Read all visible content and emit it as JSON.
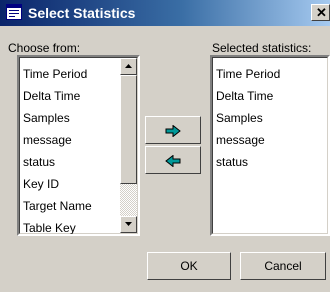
{
  "window": {
    "title": "Select Statistics",
    "close_label": "✕"
  },
  "left_panel": {
    "label": "Choose from:",
    "items": [
      "Time Period",
      "Delta Time",
      "Samples",
      "message",
      "status",
      "Key ID",
      "Target Name",
      "Table Key"
    ]
  },
  "right_panel": {
    "label": "Selected statistics:",
    "items": [
      "Time Period",
      "Delta Time",
      "Samples",
      "message",
      "status"
    ]
  },
  "transfer": {
    "add_icon": "arrow-right-icon",
    "remove_icon": "arrow-left-icon",
    "arrow_color": "#009999"
  },
  "buttons": {
    "ok": "OK",
    "cancel": "Cancel"
  }
}
